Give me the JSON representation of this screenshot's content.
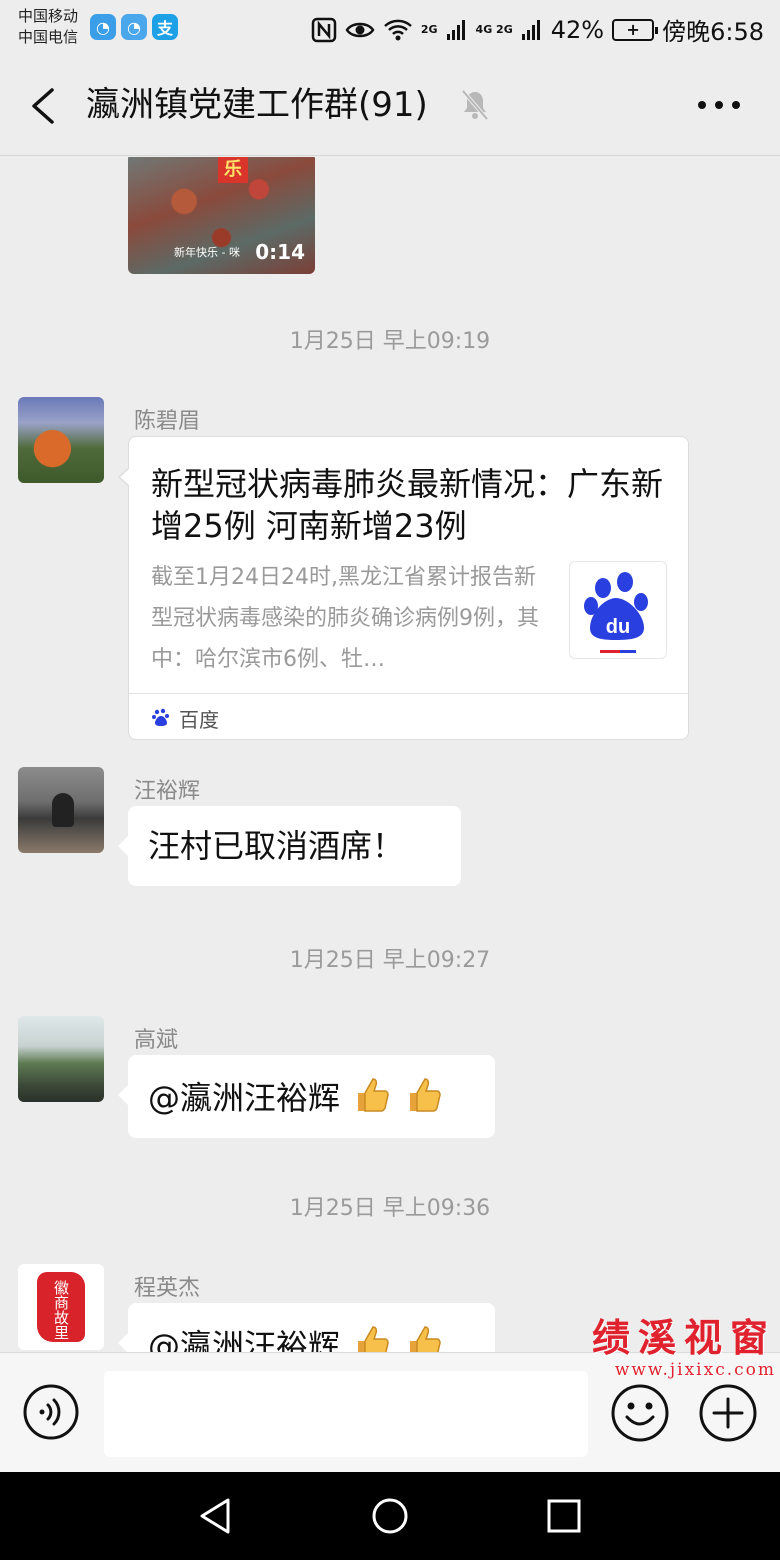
{
  "status_bar": {
    "carrier_1": "中国移动",
    "carrier_2": "中国电信",
    "app_icon_3": "支",
    "network_2g": "2G",
    "network_4g": "4G 2G",
    "battery_percent": "42%",
    "time": "傍晚6:58"
  },
  "header": {
    "title": "瀛洲镇党建工作群(91)",
    "icons": [
      "back-arrow-icon",
      "mute-bell-icon",
      "more-icon"
    ]
  },
  "messages": {
    "video": {
      "badge": "乐",
      "caption": "新年快乐 - 咪",
      "duration": "0:14"
    },
    "ts1": "1月25日 早上09:19",
    "m1": {
      "sender": "陈碧眉",
      "link_title": "新型冠状病毒肺炎最新情况：广东新增25例 河南新增23例",
      "link_desc": "截至1月24日24时,黑龙江省累计报告新型冠状病毒感染的肺炎确诊病例9例，其中：哈尔滨市6例、牡…",
      "link_source": "百度",
      "thumb_text": "du"
    },
    "m2": {
      "sender": "汪裕辉",
      "text": "汪村已取消酒席！"
    },
    "ts2": "1月25日 早上09:27",
    "m3": {
      "sender": "高斌",
      "text": "@瀛洲汪裕辉"
    },
    "ts3": "1月25日 早上09:36",
    "m4": {
      "sender": "程英杰",
      "text": "@瀛洲汪裕辉",
      "avatar_text": "徽商故里"
    }
  },
  "watermark": {
    "brand": "绩溪视窗",
    "url": "www.jixixc.com"
  },
  "colors": {
    "background": "#ededed",
    "bubble": "#ffffff",
    "baidu_blue": "#2a3fe0",
    "watermark_red": "#e0222e"
  }
}
